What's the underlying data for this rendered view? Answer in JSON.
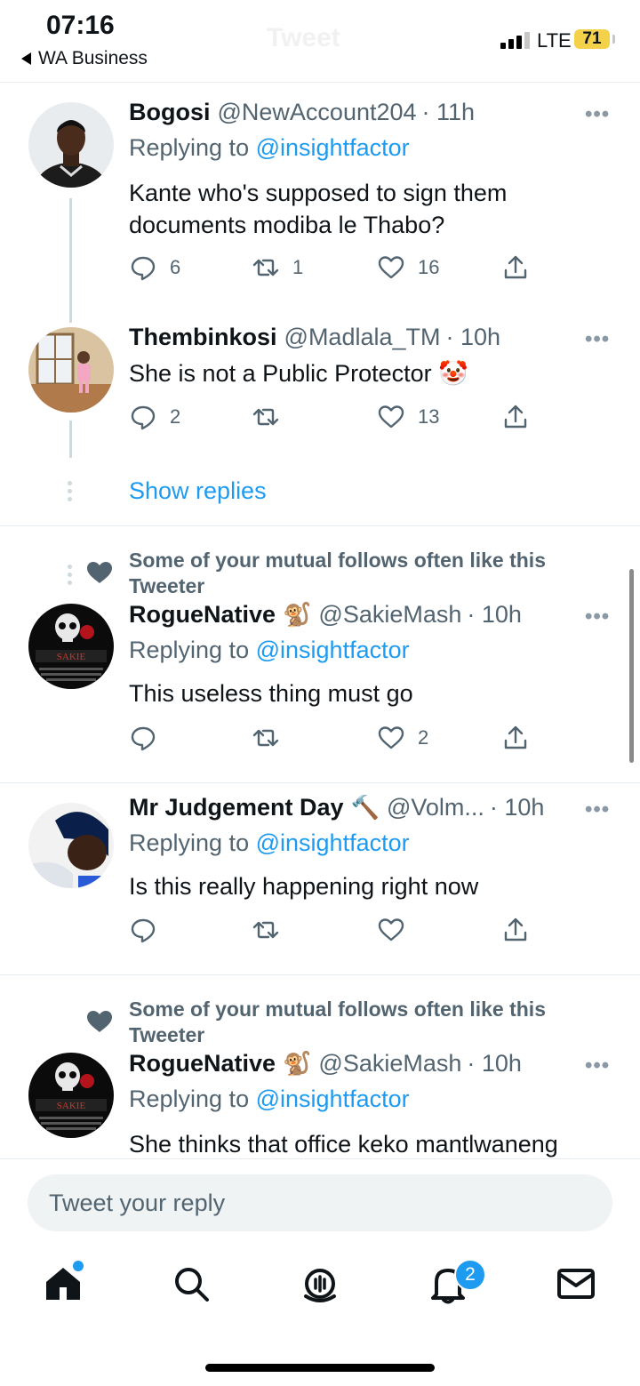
{
  "status_bar": {
    "time": "07:16",
    "back_app": "WA Business",
    "screen_title": "Tweet",
    "network": "LTE",
    "battery": "71"
  },
  "tweets": [
    {
      "name": "Bogosi",
      "handle": "@NewAccount204",
      "time": "· 11h",
      "replying_prefix": "Replying to",
      "replying_to": "@insightfactor",
      "text": "Kante who's supposed to sign them documents modiba le Thabo?",
      "replies": "6",
      "retweets": "1",
      "likes": "16"
    },
    {
      "name": "Thembinkosi",
      "handle": "@Madlala_TM",
      "time": "· 10h",
      "text": "She is not a Public Protector 🤡",
      "replies": "2",
      "retweets": "",
      "likes": "13"
    },
    {
      "context": "Some of your mutual follows often like this Tweeter",
      "name": "RogueNative",
      "name_emoji": "🐒",
      "handle": "@SakieMash",
      "time": "· 10h",
      "replying_prefix": "Replying to",
      "replying_to": "@insightfactor",
      "text": "This useless thing must go",
      "replies": "",
      "retweets": "",
      "likes": "2"
    },
    {
      "name": "Mr Judgement Day",
      "name_emoji": "🔨",
      "handle": "@Volm...",
      "time": "· 10h",
      "replying_prefix": "Replying to",
      "replying_to": "@insightfactor",
      "text": "Is this really happening right now",
      "replies": "",
      "retweets": "",
      "likes": ""
    },
    {
      "context": "Some of your mutual follows often like this Tweeter",
      "name": "RogueNative",
      "name_emoji": "🐒",
      "handle": "@SakieMash",
      "time": "· 10h",
      "replying_prefix": "Replying to",
      "replying_to": "@insightfactor",
      "text": "She thinks that office keko mantlwaneng"
    }
  ],
  "show_replies": "Show replies",
  "more_glyph": "•••",
  "avatar_text": {
    "sakie": "SAKIE"
  },
  "reply_placeholder": "Tweet your reply",
  "tabbar": {
    "notifications_badge": "2",
    "icons": [
      "home-icon",
      "search-icon",
      "spaces-icon",
      "notifications-icon",
      "messages-icon"
    ]
  },
  "colors": {
    "accent": "#1d9bf0",
    "text": "#0f1419",
    "secondary": "#536471",
    "battery": "#f3d24a"
  }
}
